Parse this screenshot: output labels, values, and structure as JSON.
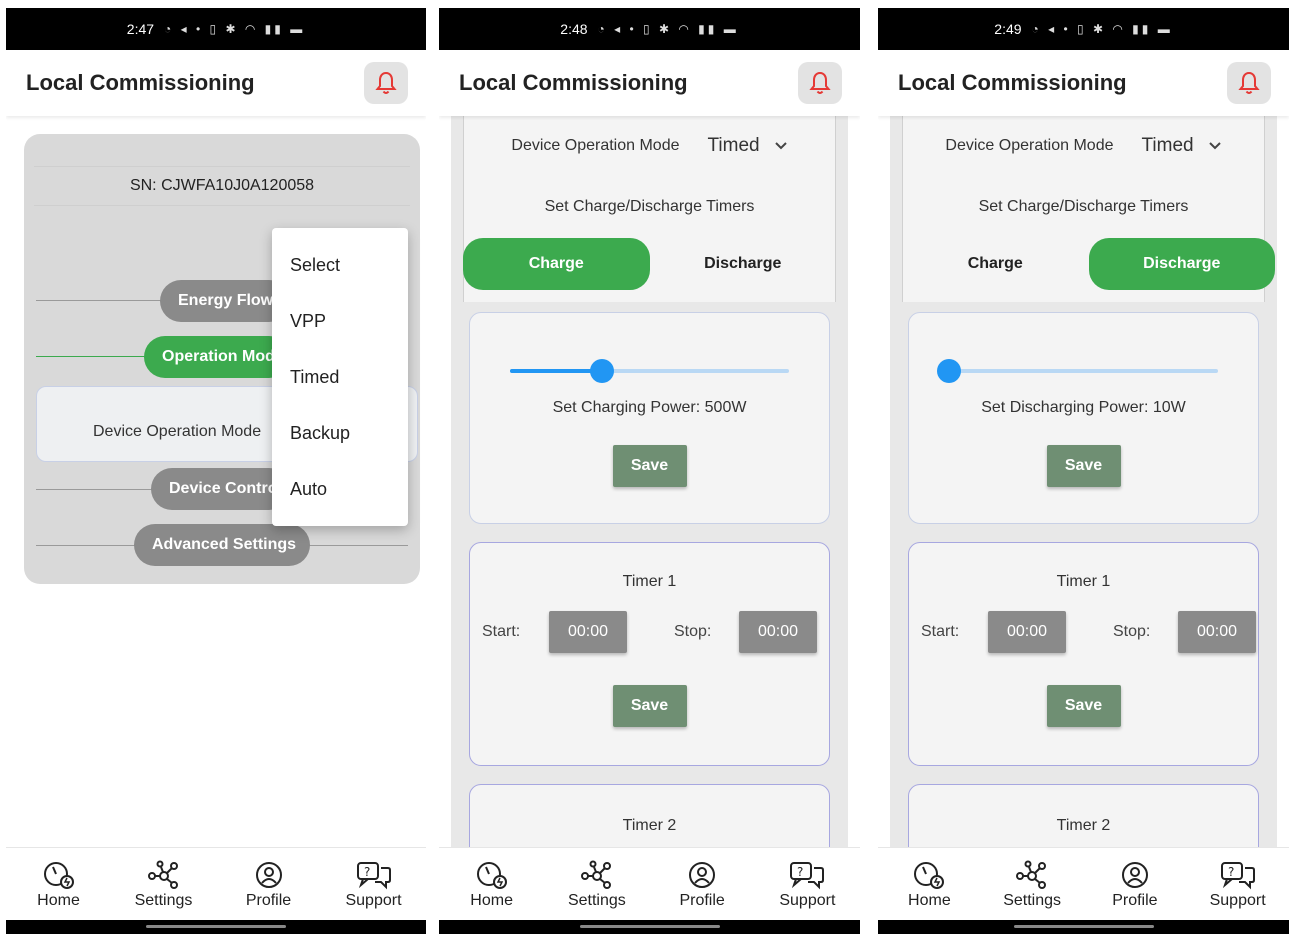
{
  "app": {
    "title": "Local Commissioning"
  },
  "nav": [
    "Home",
    "Settings",
    "Profile",
    "Support"
  ],
  "panels": [
    {
      "time": "2:47",
      "serial": "SN: CJWFA10J0A120058",
      "buttons": [
        "Energy Flow",
        "Operation Mod",
        "Device Contro",
        "Advanced Settings"
      ],
      "device_mode_label": "Device Operation Mode",
      "menu": [
        "Select",
        "VPP",
        "Timed",
        "Backup",
        "Auto"
      ]
    },
    {
      "time": "2:48",
      "device_mode_label": "Device Operation Mode",
      "device_mode_value": "Timed",
      "timers_label": "Set Charge/Discharge Timers",
      "tabs": [
        "Charge",
        "Discharge"
      ],
      "active_tab": 0,
      "slider_fraction": 0.33,
      "power_label": "Set Charging Power: 500W",
      "save_label": "Save",
      "timer1": {
        "title": "Timer 1",
        "start_label": "Start:",
        "start": "00:00",
        "stop_label": "Stop:",
        "stop": "00:00"
      },
      "timer2_title": "Timer 2"
    },
    {
      "time": "2:49",
      "device_mode_label": "Device Operation Mode",
      "device_mode_value": "Timed",
      "timers_label": "Set Charge/Discharge Timers",
      "tabs": [
        "Charge",
        "Discharge"
      ],
      "active_tab": 1,
      "slider_fraction": 0.0,
      "power_label": "Set Discharging Power: 10W",
      "save_label": "Save",
      "timer1": {
        "title": "Timer 1",
        "start_label": "Start:",
        "start": "00:00",
        "stop_label": "Stop:",
        "stop": "00:00"
      },
      "timer2_title": "Timer 2"
    }
  ],
  "colors": {
    "accent_green": "#3caa4e",
    "slider_blue": "#2196f3",
    "save_green": "#6f8f73",
    "bell_red": "#e53935"
  }
}
